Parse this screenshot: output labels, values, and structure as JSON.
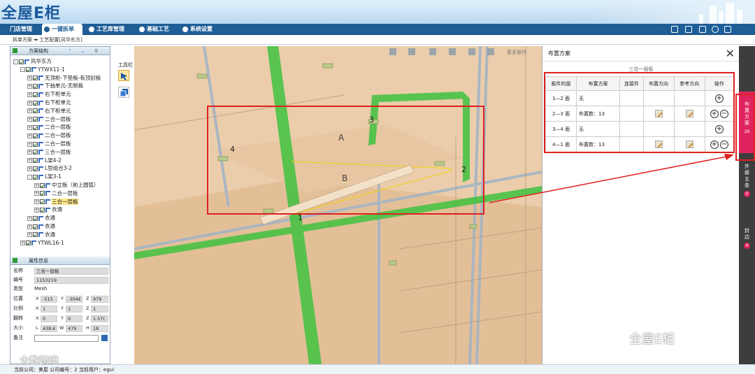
{
  "app": {
    "logo": "全屋E柜"
  },
  "menu": [
    {
      "label": "门店管理"
    },
    {
      "label": "一键拆单"
    },
    {
      "label": "工艺库管理"
    },
    {
      "label": "基础工艺"
    },
    {
      "label": "系统设置"
    }
  ],
  "breadcrumb": "拆单方案 ➡ 工艺配置[风华东方]",
  "left": {
    "tree_title": "方案结构",
    "tree": [
      {
        "label": "风华东方",
        "level": 0,
        "exp": "-"
      },
      {
        "label": "YTWX11-1",
        "level": 1,
        "exp": "-"
      },
      {
        "label": "无顶柜-下垫板-有顶封板",
        "level": 2,
        "exp": "+"
      },
      {
        "label": "下抽单元-无侧板",
        "level": 2,
        "exp": "+"
      },
      {
        "label": "右下柜单元",
        "level": 2,
        "exp": "+"
      },
      {
        "label": "右下柜单元",
        "level": 2,
        "exp": "+"
      },
      {
        "label": "右下柜单元",
        "level": 2,
        "exp": "+"
      },
      {
        "label": "二合一层板",
        "level": 2,
        "exp": "+"
      },
      {
        "label": "二合一层板",
        "level": 2,
        "exp": "+"
      },
      {
        "label": "二合一层板",
        "level": 2,
        "exp": "+"
      },
      {
        "label": "二合一层板",
        "level": 2,
        "exp": "+"
      },
      {
        "label": "三合一层板",
        "level": 2,
        "exp": "+"
      },
      {
        "label": "L架4-2",
        "level": 2,
        "exp": "+"
      },
      {
        "label": "L型组合3-2",
        "level": 2,
        "exp": "+"
      },
      {
        "label": "L架3-1",
        "level": 2,
        "exp": "-"
      },
      {
        "label": "中立板（前上圆弧）",
        "level": 3,
        "exp": "+"
      },
      {
        "label": "二合一层板",
        "level": 3,
        "exp": "+"
      },
      {
        "label": "三合一层板",
        "level": 3,
        "exp": "+",
        "selected": true
      },
      {
        "label": "衣通",
        "level": 3,
        "exp": "+"
      },
      {
        "label": "衣通",
        "level": 2,
        "exp": "+"
      },
      {
        "label": "衣通",
        "level": 2,
        "exp": "+"
      },
      {
        "label": "衣通",
        "level": 2,
        "exp": "+"
      },
      {
        "label": "YTWL16-1",
        "level": 1,
        "exp": "+"
      }
    ],
    "props_title": "属性信息",
    "props": {
      "name_label": "名称",
      "name": "三合一层板",
      "code_label": "编号",
      "code": "1153219",
      "type_label": "类型",
      "type": "Mesh",
      "pos_label": "位置",
      "pos_x": "-515",
      "pos_y": "-304£",
      "pos_z": "979",
      "scale_label": "比例",
      "scale_x": "1",
      "scale_y": "1",
      "scale_z": "1",
      "rot_label": "翻转",
      "rot_x": "0",
      "rot_y": "0",
      "rot_z": "1.57(",
      "size_label": "大小",
      "size_l": "439.€",
      "size_w": "479",
      "size_h": "18",
      "note_label": "备注",
      "note": ""
    }
  },
  "tools": {
    "title": "工具栏"
  },
  "viewport": {
    "toolbar_right": "更多操作",
    "labels": {
      "a": "A",
      "b": "B",
      "p1": "1",
      "p2": "2",
      "p3": "3",
      "p4": "4"
    }
  },
  "panel": {
    "title": "布置方案",
    "sub": "三合一层板",
    "headers": [
      "板件的面",
      "布置方案",
      "连接件",
      "布置方向",
      "参考方向",
      "操作"
    ],
    "rows": [
      {
        "face": "1—2 面",
        "plan": "无",
        "edit": false,
        "ops": "add"
      },
      {
        "face": "2—3 面",
        "plan": "布置数：13",
        "edit": true,
        "ops": "both"
      },
      {
        "face": "3—4 面",
        "plan": "无",
        "edit": false,
        "ops": "add"
      },
      {
        "face": "4—1 面",
        "plan": "布置数：13",
        "edit": true,
        "ops": "both"
      }
    ]
  },
  "side": {
    "tabs": [
      {
        "label": "布置方案",
        "count": "26"
      },
      {
        "label": "外部五金",
        "count": "0"
      },
      {
        "label": "封边",
        "count": "4"
      }
    ]
  },
  "status": "当前公司：美屋    公司编号：2    当前用户：egui",
  "watermark": {
    "right": "全屋E柜",
    "left": "大数跨境"
  }
}
